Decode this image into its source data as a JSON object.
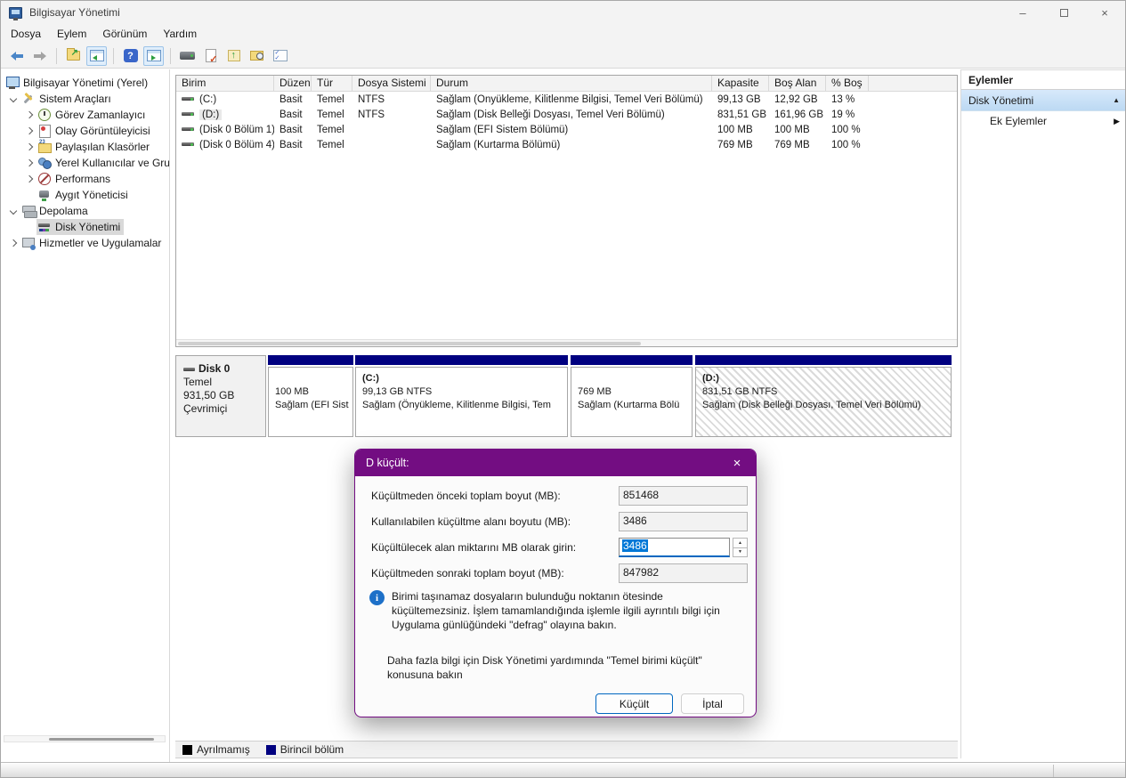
{
  "window": {
    "title": "Bilgisayar Yönetimi",
    "controls": {
      "minimize": "–",
      "maximize": "",
      "close": "×"
    }
  },
  "menu": {
    "items": [
      "Dosya",
      "Eylem",
      "Görünüm",
      "Yardım"
    ]
  },
  "toolbar": {
    "icons": [
      "back-icon",
      "forward-icon",
      "export-folder-icon",
      "show-console-tree-icon",
      "help-icon",
      "show-action-pane-icon",
      "device-icon",
      "validate-document-icon",
      "upload-icon",
      "search-folder-icon",
      "checklist-icon"
    ]
  },
  "tree": {
    "items": [
      {
        "label": "Bilgisayar Yönetimi (Yerel)",
        "icon": "computer-icon",
        "expander": "none"
      },
      {
        "label": "Sistem Araçları",
        "icon": "tools-icon",
        "expander": "down"
      },
      {
        "label": "Görev Zamanlayıcı",
        "icon": "clock-icon",
        "expander": "right"
      },
      {
        "label": "Olay Görüntüleyicisi",
        "icon": "event-viewer-icon",
        "expander": "right"
      },
      {
        "label": "Paylaşılan Klasörler",
        "icon": "shared-folders-icon",
        "expander": "right"
      },
      {
        "label": "Yerel Kullanıcılar ve Gru",
        "icon": "users-icon",
        "expander": "right"
      },
      {
        "label": "Performans",
        "icon": "performance-icon",
        "expander": "right"
      },
      {
        "label": "Aygıt Yöneticisi",
        "icon": "device-manager-icon",
        "expander": "none"
      },
      {
        "label": "Depolama",
        "icon": "storage-icon",
        "expander": "down"
      },
      {
        "label": "Disk Yönetimi",
        "icon": "disk-management-icon",
        "expander": "none",
        "selected": true
      },
      {
        "label": "Hizmetler ve Uygulamalar",
        "icon": "services-icon",
        "expander": "right"
      }
    ]
  },
  "volume_table": {
    "columns": [
      "Birim",
      "Düzen",
      "Tür",
      "Dosya Sistemi",
      "Durum",
      "Kapasite",
      "Boş Alan",
      "% Boş"
    ],
    "rows": [
      {
        "birim": "(C:)",
        "duzen": "Basit",
        "tur": "Temel",
        "fs": "NTFS",
        "durum": "Sağlam (Önyükleme, Kilitlenme Bilgisi, Temel Veri Bölümü)",
        "kapasite": "99,13 GB",
        "bos": "12,92 GB",
        "pbos": "13 %"
      },
      {
        "birim": "(D:)",
        "duzen": "Basit",
        "tur": "Temel",
        "fs": "NTFS",
        "durum": "Sağlam (Disk Belleği Dosyası, Temel Veri Bölümü)",
        "kapasite": "831,51 GB",
        "bos": "161,96 GB",
        "pbos": "19 %"
      },
      {
        "birim": "(Disk 0 Bölüm 1)",
        "duzen": "Basit",
        "tur": "Temel",
        "fs": "",
        "durum": "Sağlam (EFI Sistem Bölümü)",
        "kapasite": "100 MB",
        "bos": "100 MB",
        "pbos": "100 %"
      },
      {
        "birim": "(Disk 0 Bölüm 4)",
        "duzen": "Basit",
        "tur": "Temel",
        "fs": "",
        "durum": "Sağlam (Kurtarma Bölümü)",
        "kapasite": "769 MB",
        "bos": "769 MB",
        "pbos": "100 %"
      }
    ]
  },
  "disk_graph": {
    "disk": {
      "name": "Disk 0",
      "type": "Temel",
      "size": "931,50 GB",
      "status": "Çevrimiçi"
    },
    "partitions": [
      {
        "line1": "",
        "line2": "100 MB",
        "line3": "Sağlam (EFI Sist"
      },
      {
        "line1": "(C:)",
        "line2": "99,13 GB NTFS",
        "line3": "Sağlam (Önyükleme, Kilitlenme Bilgisi, Tem"
      },
      {
        "line1": "",
        "line2": "769 MB",
        "line3": "Sağlam (Kurtarma Bölü"
      },
      {
        "line1": "(D:)",
        "line2": "831,51 GB NTFS",
        "line3": "Sağlam (Disk Belleği Dosyası, Temel Veri Bölümü)"
      }
    ]
  },
  "legend": {
    "items": [
      {
        "label": "Ayrılmamış",
        "color": "#000000"
      },
      {
        "label": "Birincil bölüm",
        "color": "#000080"
      }
    ]
  },
  "actions_panel": {
    "title": "Eylemler",
    "group_label": "Disk Yönetimi",
    "item_label": "Ek Eylemler"
  },
  "dialog": {
    "title": "D küçült:",
    "fields": [
      {
        "label": "Küçültmeden önceki toplam boyut (MB):",
        "value": "851468"
      },
      {
        "label": "Kullanılabilen küçültme alanı boyutu (MB):",
        "value": "3486"
      },
      {
        "label": "Küçültülecek alan miktarını MB olarak girin:",
        "value": "3486"
      },
      {
        "label": "Küçültmeden sonraki toplam boyut (MB):",
        "value": "847982"
      }
    ],
    "info_text": "Birimi taşınamaz dosyaların bulunduğu noktanın ötesinde küçültemezsiniz. İşlem tamamlandığında işlemle ilgili ayrıntılı bilgi için Uygulama günlüğündeki \"defrag\" olayına bakın.",
    "help_text": "Daha fazla bilgi için Disk Yönetimi yardımında \"Temel birimi küçült\" konusuna bakın",
    "buttons": {
      "shrink": "Küçült",
      "cancel": "İptal"
    }
  },
  "colors": {
    "dialog_accent": "#730d82",
    "partition_bar": "#000080",
    "selection_blue": "#0078d7",
    "default_button_border": "#0067c0",
    "unallocated": "#000000",
    "primary_partition": "#000080"
  }
}
